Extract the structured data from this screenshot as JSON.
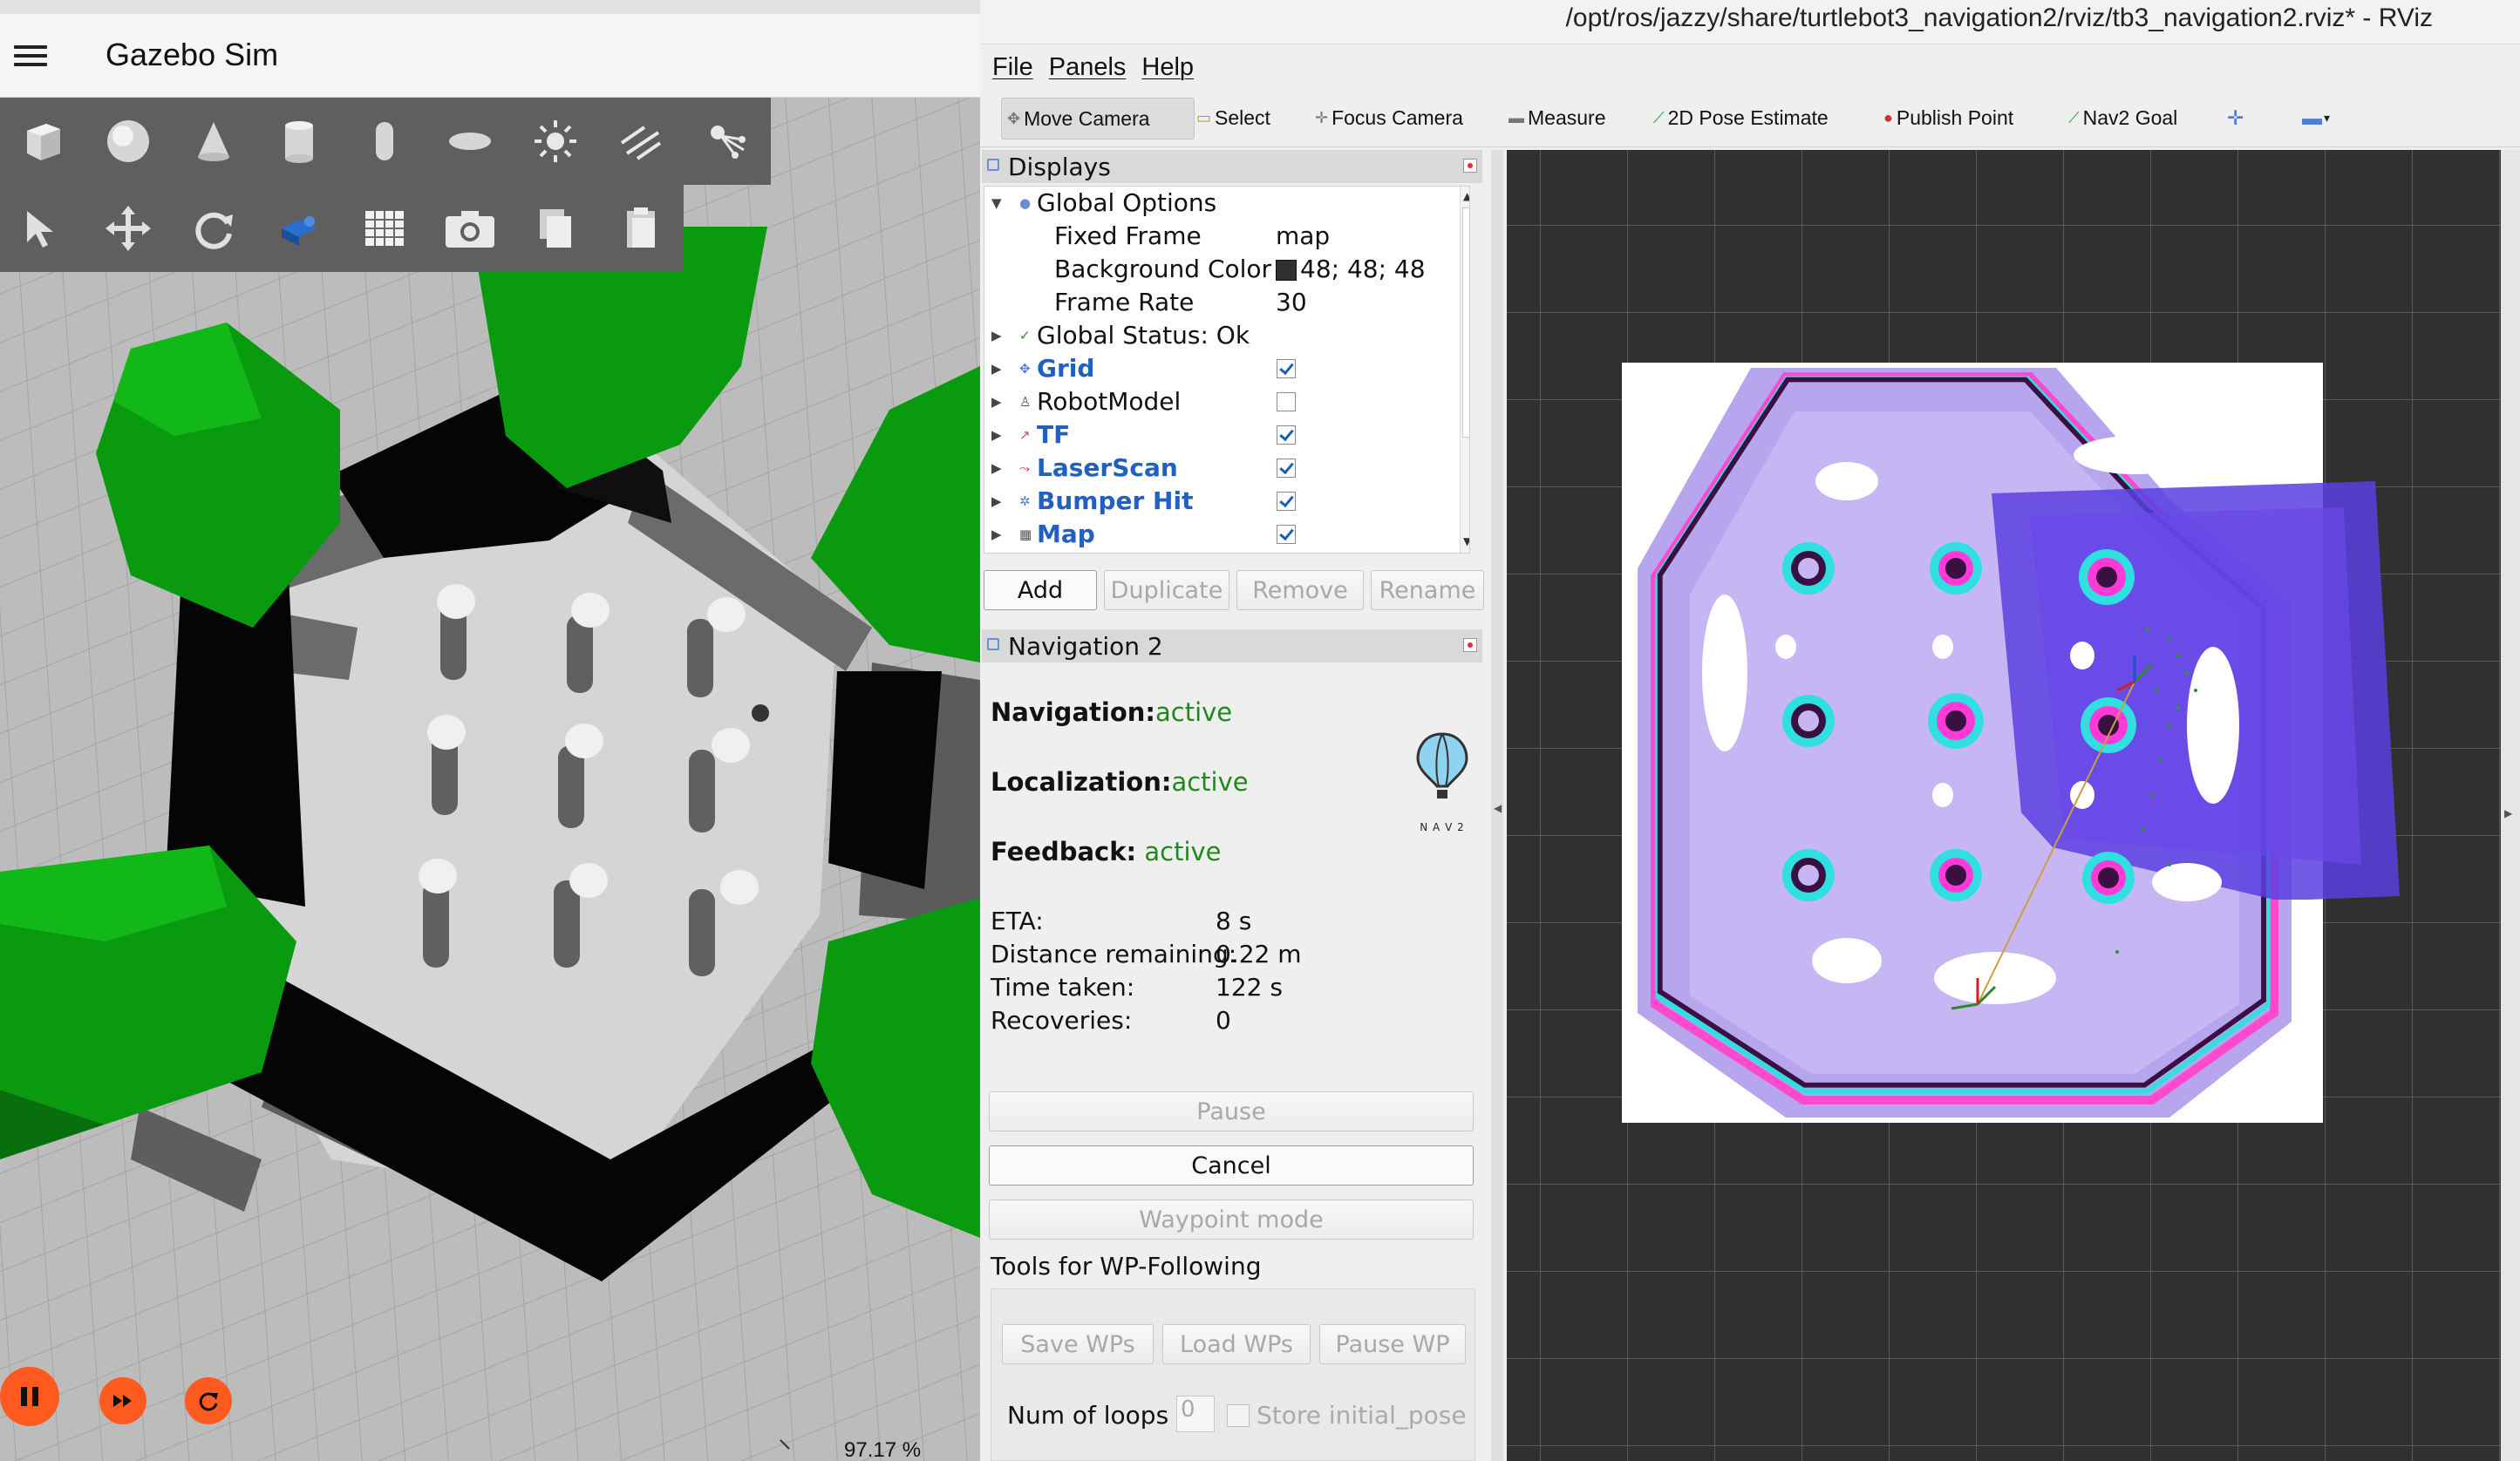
{
  "gazebo": {
    "title": "Gazebo Sim",
    "shape_tools": [
      "box-icon",
      "sphere-icon",
      "cone-icon",
      "cylinder-icon",
      "capsule-icon",
      "ellipsoid-icon",
      "sun-light-icon",
      "directional-light-icon",
      "spot-light-icon"
    ],
    "edit_tools": [
      "select-arrow-icon",
      "translate-icon",
      "rotate-icon",
      "transform-icon",
      "grid-icon",
      "screenshot-icon",
      "copy-icon",
      "paste-icon"
    ],
    "rtf": "97.17 %",
    "controls": [
      "pause-icon",
      "step-icon",
      "reset-icon"
    ]
  },
  "rviz": {
    "window_title": "/opt/ros/jazzy/share/turtlebot3_navigation2/rviz/tb3_navigation2.rviz* - RViz",
    "menu": [
      "File",
      "Panels",
      "Help"
    ],
    "tools": [
      {
        "label": "Move Camera",
        "active": true
      },
      {
        "label": "Select",
        "active": false
      },
      {
        "label": "Focus Camera",
        "active": false
      },
      {
        "label": "Measure",
        "active": false
      },
      {
        "label": "2D Pose Estimate",
        "active": false
      },
      {
        "label": "Publish Point",
        "active": false
      },
      {
        "label": "Nav2 Goal",
        "active": false
      }
    ],
    "displays": {
      "title": "Displays",
      "global_options": "Global Options",
      "fixed_frame_label": "Fixed Frame",
      "fixed_frame_value": "map",
      "background_label": "Background Color",
      "background_value": "48; 48; 48",
      "frame_rate_label": "Frame Rate",
      "frame_rate_value": "30",
      "global_status": "Global Status: Ok",
      "items": [
        {
          "label": "Grid",
          "checked": true,
          "bold": true
        },
        {
          "label": "RobotModel",
          "checked": false,
          "bold": false
        },
        {
          "label": "TF",
          "checked": true,
          "bold": true
        },
        {
          "label": "LaserScan",
          "checked": true,
          "bold": true
        },
        {
          "label": "Bumper Hit",
          "checked": true,
          "bold": true
        },
        {
          "label": "Map",
          "checked": true,
          "bold": true
        }
      ],
      "buttons": {
        "add": "Add",
        "duplicate": "Duplicate",
        "remove": "Remove",
        "rename": "Rename"
      }
    },
    "nav2": {
      "title": "Navigation 2",
      "navigation_label": "Navigation:",
      "navigation_value": "active",
      "localization_label": "Localization:",
      "localization_value": "active",
      "feedback_label": "Feedback:",
      "feedback_value": "active",
      "logo_text": "N A V 2",
      "eta_label": "ETA:",
      "eta_value": "8 s",
      "distance_label": "Distance remaining:",
      "distance_value": "0.22 m",
      "time_label": "Time taken:",
      "time_value": "122 s",
      "recoveries_label": "Recoveries:",
      "recoveries_value": "0",
      "pause": "Pause",
      "cancel": "Cancel",
      "waypoint_mode": "Waypoint mode",
      "wp_title": "Tools for WP-Following",
      "save_wps": "Save WPs",
      "load_wps": "Load WPs",
      "pause_wp": "Pause WP",
      "num_loops_label": "Num of loops",
      "num_loops_value": "0",
      "store_initial_pose": "Store initial_pose"
    },
    "colors": {
      "background": "#303030",
      "grid": "#5a5a5a",
      "costmap_light": "#b9a6ee",
      "costmap_cyan": "#33e6e6",
      "costmap_magenta": "#ff3ad7",
      "wall": "#3a1040"
    }
  }
}
